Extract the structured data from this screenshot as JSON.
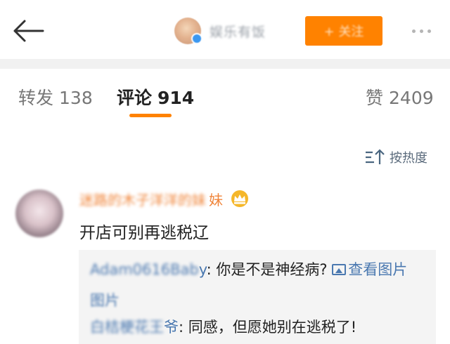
{
  "header": {
    "back_icon": "arrow-left-icon",
    "account_name": "娱乐有饭",
    "follow_label": "+ 关注",
    "more_icon": "more-dots-icon",
    "accent": "#ff8200"
  },
  "tabs": [
    {
      "label": "转发",
      "count": "138"
    },
    {
      "label": "评论",
      "count": "914"
    },
    {
      "label": "赞",
      "count": "2409"
    }
  ],
  "sort": {
    "icon": "sort-icon",
    "label": "按热度"
  },
  "comment": {
    "username_blurred": "迷路的木子洋洋的妹",
    "username_visible": "妹",
    "badge_icon": "crown-icon",
    "text": "开店可别再逃税辽",
    "replies": [
      {
        "user_blurred": "Adam0616Bab",
        "user_visible": "y",
        "text": ": 你是不是神经病?",
        "link": "查看图片",
        "link_wrapped": "图片",
        "link_icon": "image-icon"
      },
      {
        "user_blurred": "白桔梗花王",
        "user_visible": "爷",
        "text": ": 同感，但愿她别在逃税了!"
      }
    ]
  }
}
